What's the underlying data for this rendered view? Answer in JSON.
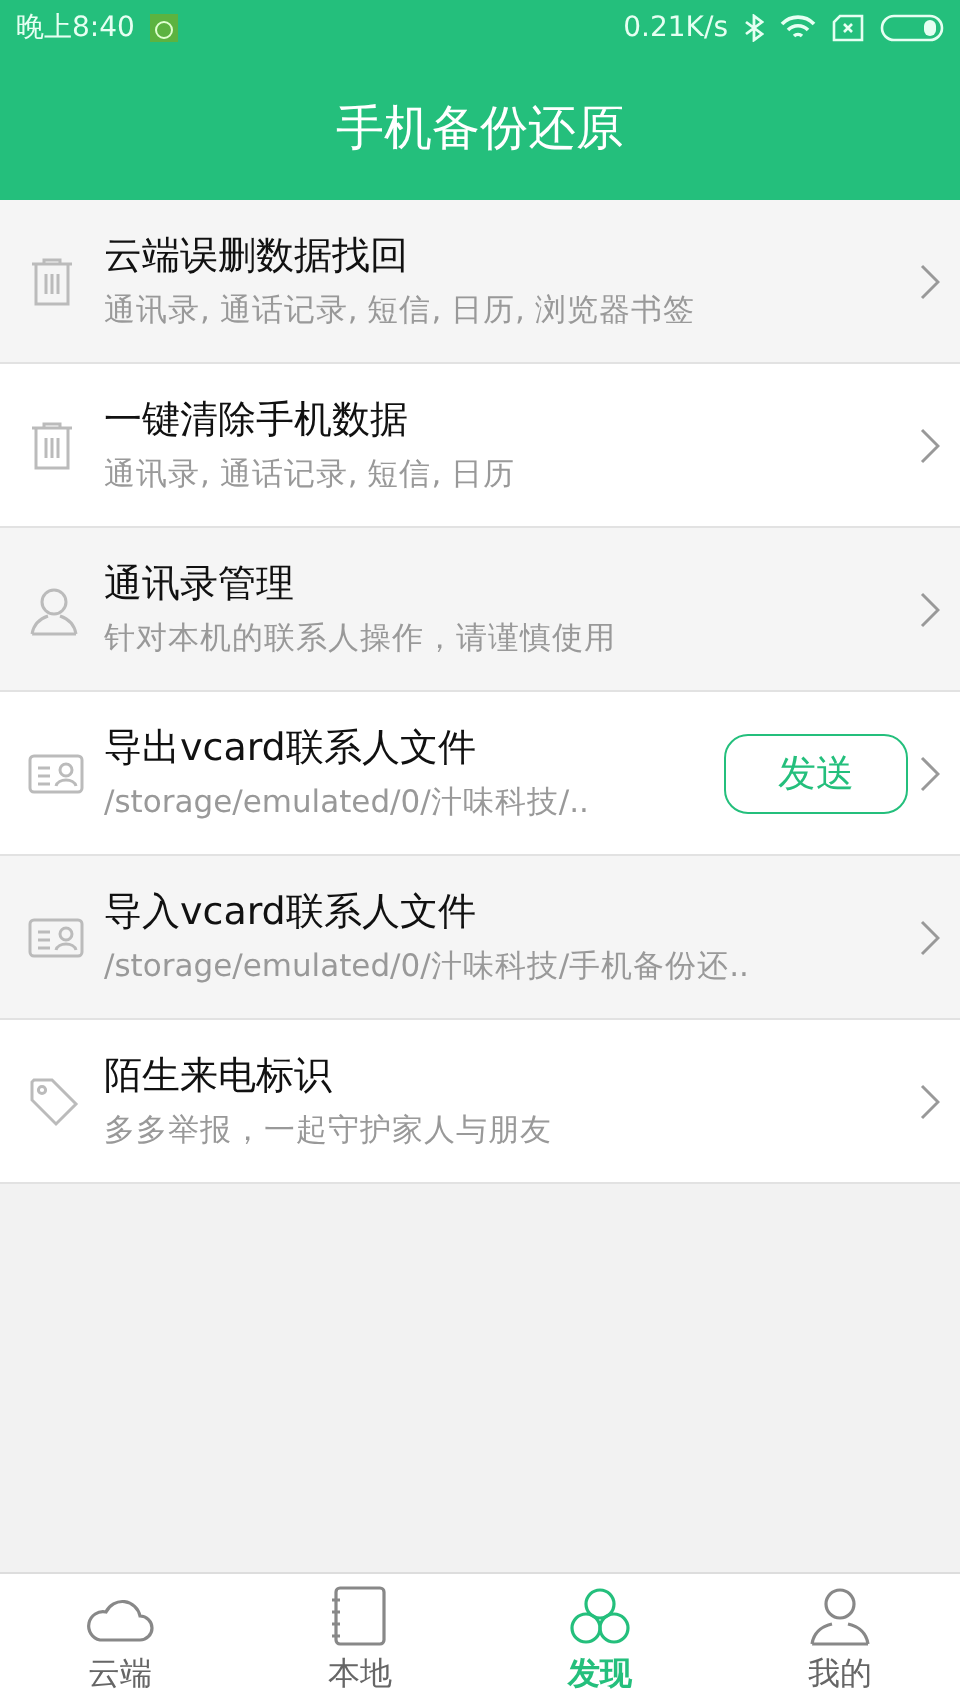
{
  "status_bar": {
    "time": "晚上8:40",
    "speed": "0.21K/s"
  },
  "header": {
    "title": "手机备份还原"
  },
  "items": [
    {
      "kind": "trash",
      "title": "云端误删数据找回",
      "subtitle": "通讯录, 通话记录, 短信, 日历, 浏览器书签"
    },
    {
      "kind": "trash",
      "title": "一键清除手机数据",
      "subtitle": "通讯录, 通话记录, 短信, 日历"
    },
    {
      "kind": "contact",
      "title": "通讯录管理",
      "subtitle": "针对本机的联系人操作，请谨慎使用"
    },
    {
      "kind": "vcard",
      "title": "导出vcard联系人文件",
      "subtitle": "/storage/emulated/0/汁味科技/..",
      "action": "发送"
    },
    {
      "kind": "vcard",
      "title": "导入vcard联系人文件",
      "subtitle": "/storage/emulated/0/汁味科技/手机备份还.."
    },
    {
      "kind": "tag",
      "title": "陌生来电标识",
      "subtitle": "多多举报，一起守护家人与朋友"
    }
  ],
  "tabs": [
    {
      "kind": "cloud",
      "label": "云端",
      "selected": false
    },
    {
      "kind": "notebook",
      "label": "本地",
      "selected": false
    },
    {
      "kind": "circles",
      "label": "发现",
      "selected": true
    },
    {
      "kind": "person",
      "label": "我的",
      "selected": false
    }
  ]
}
